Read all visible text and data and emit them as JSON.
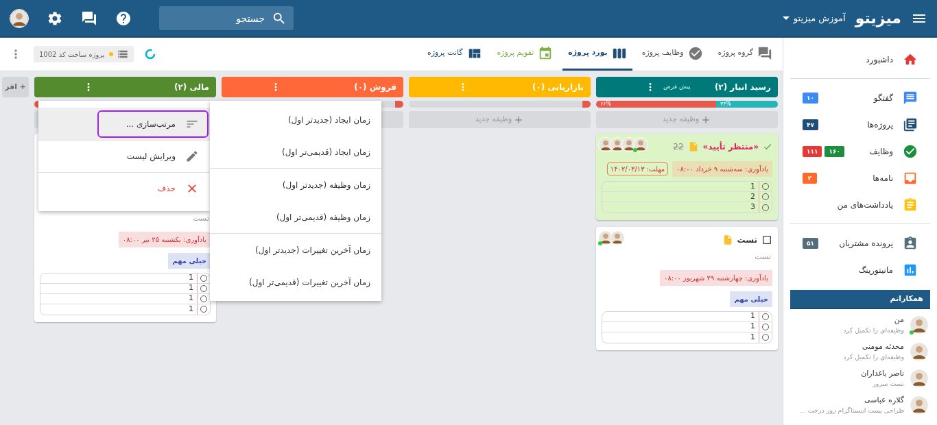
{
  "topbar": {
    "logo": "میزیتو",
    "workspace": "آموزش میزیتو",
    "search": {
      "placeholder": "جستجو"
    }
  },
  "toolbar": {
    "tabs": [
      {
        "label": "گروه پروژه",
        "selected": false,
        "color": "#555555"
      },
      {
        "label": "وظایف پروژه",
        "selected": false,
        "color": "#555555"
      },
      {
        "label": "بورد پروژه",
        "selected": true,
        "color": "#1f4e79"
      },
      {
        "label": "تقویم پروژه",
        "selected": false,
        "color": "#7cb342"
      },
      {
        "label": "گانت پروژه",
        "selected": false,
        "color": "#1f4e79"
      }
    ],
    "project_chip": "پروژه ساخت کد 1002"
  },
  "board": {
    "columns": [
      {
        "title": "رسید انبار (۲)",
        "subtitle": "پیش فرض",
        "color": "#00797a",
        "progress": [
          {
            "label": "۳۳%",
            "level": 0.34,
            "color": "#26b5b8"
          },
          {
            "label": "۶۶%",
            "level": 0.66,
            "color": "#e8584b"
          }
        ],
        "new_task": "وظیفه جدید",
        "cards": [
          {
            "checked": true,
            "status": "«منتظر تأیید»",
            "number": "22",
            "color": "#ddf5c6",
            "avatars": [
              {
                "online": false
              },
              {
                "online": false
              },
              {
                "online": false
              },
              {
                "online": true
              }
            ],
            "reminder": {
              "text": "یادآوری: سه‌شنبه ۹ خرداد ۰۸:۰۰",
              "color": "#e8dfb4"
            },
            "deadline": "مهلت: ۱۴۰۲/۰۳/۱۳",
            "checklist": [
              {
                "text": "1",
                "checked": false
              },
              {
                "text": "2",
                "checked": false
              },
              {
                "text": "3",
                "checked": false
              }
            ]
          },
          {
            "checked": false,
            "title": "تست",
            "color": "#ffffff",
            "avatars": [
              {
                "online": true
              },
              {
                "online": false
              }
            ],
            "description": "تست",
            "reminder": {
              "text": "یادآوری: چهارشنبه ۲۹ شهریور ۰۸:۰۰",
              "color": "#f8dede"
            },
            "tag": "خیلی مهم",
            "checklist": [
              {
                "text": "1",
                "checked": false
              },
              {
                "text": "1",
                "checked": false
              },
              {
                "text": "1",
                "checked": false
              }
            ]
          }
        ]
      },
      {
        "title": "بازاریابی (۰)",
        "color": "#ffb900",
        "progress": [
          {
            "level": 0,
            "color": "#e8584b"
          }
        ],
        "new_task": "وظیفه جدید"
      },
      {
        "title": "فروش (۰)",
        "color": "#ff6838",
        "progress": [
          {
            "level": 0,
            "color": "#e8584b"
          }
        ]
      },
      {
        "title": "مالی (۲)",
        "color": "#558b2f",
        "progress": [
          {
            "level": 1,
            "color": "#e8584b"
          }
        ],
        "cards": [
          {
            "color": "#ffffff",
            "description": "تست",
            "reminder": {
              "text": "یادآوری: یکشنبه ۲۵ تیر ۰۸:۰۰",
              "color": "#f8dede"
            },
            "tag": "خیلی مهم",
            "checklist": [
              {
                "text": "1",
                "checked": false
              },
              {
                "text": "1",
                "checked": false
              },
              {
                "text": "1",
                "checked": false
              },
              {
                "text": "1",
                "checked": false
              }
            ]
          }
        ]
      }
    ],
    "add_list": "+ افز"
  },
  "column_menu": {
    "items": [
      {
        "kind": "sort",
        "label": "مرتب‌سازی ...",
        "selected": true
      },
      {
        "kind": "edit",
        "label": "ویرایش لیست",
        "selected": false
      },
      {
        "kind": "delete",
        "label": "حذف",
        "selected": false
      }
    ]
  },
  "sort_menu": {
    "groups": [
      {
        "items": [
          "زمان ایجاد (جدیدتر اول)",
          "زمان ایجاد (قدیمی‌تر اول)"
        ]
      },
      {
        "items": [
          "زمان وظیفه (جدیدتر اول)",
          "زمان وظیفه (قدیمی‌تر اول)"
        ]
      },
      {
        "items": [
          "زمان آخرین تغییرات (جدیدتر اول)",
          "زمان آخرین تغییرات (قدیمی‌تر اول)"
        ]
      }
    ]
  },
  "sidebar": {
    "sections": [
      {
        "items": [
          {
            "label": "داشبورد"
          }
        ]
      },
      {
        "items": [
          {
            "label": "گفتگو",
            "badges": [
              {
                "text": "۱۰",
                "color": "#3d8af7"
              }
            ]
          },
          {
            "label": "پروژه‌ها",
            "badges": [
              {
                "text": "۴۷",
                "color": "#1f4e79"
              }
            ]
          },
          {
            "label": "وظایف",
            "badges": [
              {
                "text": "۱۶۰",
                "color": "#1e8e3e"
              },
              {
                "text": "۱۱۱",
                "color": "#e53935"
              }
            ]
          },
          {
            "label": "نامه‌ها",
            "badges": [
              {
                "text": "۲",
                "color": "#ff6a2b"
              }
            ]
          },
          {
            "label": "یادداشت‌های من"
          }
        ]
      },
      {
        "items": [
          {
            "label": "پرونده مشتریان",
            "badges": [
              {
                "text": "۵۱",
                "color": "#546e7a"
              }
            ]
          },
          {
            "label": "مانیتورینگ"
          }
        ]
      }
    ],
    "colleagues": {
      "title": "همکارانم",
      "items": [
        {
          "name": "من",
          "status": "وظیفه‌ای را تکمیل کرد",
          "online": true
        },
        {
          "name": "محدثه مومنی",
          "status": "وظیفه‌ای را تکمیل کرد",
          "online": false
        },
        {
          "name": "ناصر باغداران",
          "status": "تست سرور",
          "online": false
        },
        {
          "name": "گلاره عباسی",
          "status": "طراحی پست اینستاگرام روز درخت ...",
          "online": false
        }
      ]
    }
  }
}
